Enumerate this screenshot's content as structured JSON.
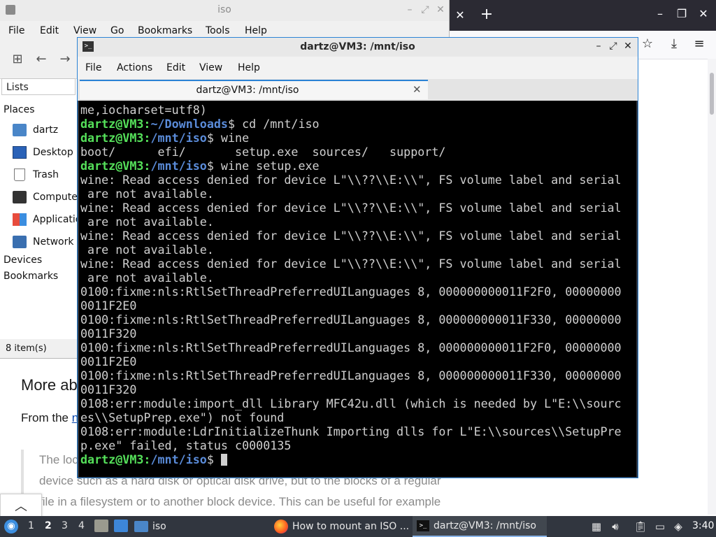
{
  "colors": {
    "prompt_user": "#55e05a",
    "prompt_path": "#5a8bd8",
    "terminal_bg": "#000000",
    "terminal_text": "#d0d0d0",
    "accent": "#2b83d5",
    "taskbar_bg": "#31363f",
    "firefox_titlebar": "#2b2a33"
  },
  "firefox": {
    "icons": [
      "close-icon",
      "plus-icon",
      "minimize-icon",
      "maximize-icon",
      "close-icon",
      "star-icon",
      "download-icon",
      "menu-icon"
    ],
    "article": {
      "heading": "More ab",
      "para_prefix": "From the",
      "para_link": "n",
      "quote_lines": [
        "The loc",
        "device such as a hard disk or optical disk drive, but to the blocks of a regular",
        "file in a filesystem or to another block device. This can be useful for example"
      ]
    }
  },
  "file_manager": {
    "title": "iso",
    "menu": [
      "File",
      "Edit",
      "View",
      "Go",
      "Bookmarks",
      "Tools",
      "Help"
    ],
    "toolbar_icons": [
      "new-window-icon",
      "back-arrow-icon",
      "forward-arrow-icon"
    ],
    "sidebar_mode": "Lists",
    "sections": {
      "places": "Places",
      "devices": "Devices",
      "bookmarks": "Bookmarks"
    },
    "places": [
      {
        "label": "dartz",
        "icon": "home-folder-icon"
      },
      {
        "label": "Desktop",
        "icon": "desktop-icon"
      },
      {
        "label": "Trash",
        "icon": "trash-icon"
      },
      {
        "label": "Compute",
        "icon": "computer-icon"
      },
      {
        "label": "Applicatio",
        "icon": "applications-icon"
      },
      {
        "label": "Network",
        "icon": "network-icon"
      }
    ],
    "status": "8 item(s)"
  },
  "terminal": {
    "title": "dartz@VM3: /mnt/iso",
    "menu": [
      "File",
      "Actions",
      "Edit",
      "View",
      "Help"
    ],
    "tab_label": "dartz@VM3: /mnt/iso",
    "lines": [
      {
        "text": "me,iocharset=utf8)"
      },
      {
        "user": "dartz@VM3",
        "path": "~/Downloads",
        "cmd": "$ cd /mnt/iso"
      },
      {
        "user": "dartz@VM3",
        "path": "/mnt/iso",
        "cmd": "$ wine"
      },
      {
        "text": "boot/      efi/       setup.exe  sources/   support/"
      },
      {
        "user": "dartz@VM3",
        "path": "/mnt/iso",
        "cmd": "$ wine setup.exe"
      },
      {
        "text": "wine: Read access denied for device L\"\\\\??\\\\E:\\\\\", FS volume label and serial"
      },
      {
        "text": " are not available."
      },
      {
        "text": "wine: Read access denied for device L\"\\\\??\\\\E:\\\\\", FS volume label and serial"
      },
      {
        "text": " are not available."
      },
      {
        "text": "wine: Read access denied for device L\"\\\\??\\\\E:\\\\\", FS volume label and serial"
      },
      {
        "text": " are not available."
      },
      {
        "text": "wine: Read access denied for device L\"\\\\??\\\\E:\\\\\", FS volume label and serial"
      },
      {
        "text": " are not available."
      },
      {
        "text": "0100:fixme:nls:RtlSetThreadPreferredUILanguages 8, 000000000011F2F0, 00000000"
      },
      {
        "text": "0011F2E0"
      },
      {
        "text": "0100:fixme:nls:RtlSetThreadPreferredUILanguages 8, 000000000011F330, 00000000"
      },
      {
        "text": "0011F320"
      },
      {
        "text": "0100:fixme:nls:RtlSetThreadPreferredUILanguages 8, 000000000011F2F0, 00000000"
      },
      {
        "text": "0011F2E0"
      },
      {
        "text": "0100:fixme:nls:RtlSetThreadPreferredUILanguages 8, 000000000011F330, 00000000"
      },
      {
        "text": "0011F320"
      },
      {
        "text": "0108:err:module:import_dll Library MFC42u.dll (which is needed by L\"E:\\\\sourc"
      },
      {
        "text": "es\\\\SetupPrep.exe\") not found"
      },
      {
        "text": "0108:err:module:LdrInitializeThunk Importing dlls for L\"E:\\\\sources\\\\SetupPre"
      },
      {
        "text": "p.exe\" failed, status c0000135"
      },
      {
        "user": "dartz@VM3",
        "path": "/mnt/iso",
        "cmd": "$ ",
        "cursor": true
      }
    ]
  },
  "taskbar": {
    "workspaces": [
      "1",
      "2",
      "3",
      "4"
    ],
    "active_workspace": "2",
    "launchers": [
      "file-manager-launcher-icon",
      "desktop-launcher-icon"
    ],
    "tasks": [
      {
        "label": "iso",
        "icon": "folder-icon"
      },
      {
        "label": "How to mount an ISO ...",
        "icon": "firefox-icon"
      },
      {
        "label": "dartz@VM3: /mnt/iso",
        "icon": "terminal-icon"
      }
    ],
    "tray_icons": [
      "trash-tray-icon",
      "volume-icon",
      "clipboard-icon",
      "network-tray-icon",
      "updates-icon"
    ],
    "clock": "3:40"
  }
}
